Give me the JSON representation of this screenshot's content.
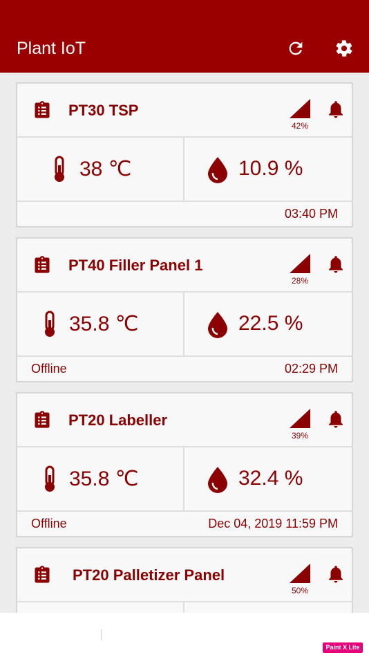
{
  "appbar": {
    "title": "Plant IoT",
    "refresh_icon": "refresh-icon",
    "settings_icon": "gear-icon"
  },
  "colors": {
    "primary": "#9b0000",
    "accent": "#8b0000",
    "background": "#ececec"
  },
  "devices": [
    {
      "name": "PT30 TSP",
      "signal": "42%",
      "temperature": "38 ℃",
      "humidity": "10.9 %",
      "status": "",
      "time": "03:40 PM"
    },
    {
      "name": "PT40 Filler Panel 1",
      "signal": "28%",
      "temperature": "35.8 ℃",
      "humidity": "22.5 %",
      "status": "Offline",
      "time": "02:29 PM"
    },
    {
      "name": "PT20 Labeller",
      "signal": "39%",
      "temperature": "35.8 ℃",
      "humidity": "32.4 %",
      "status": "Offline",
      "time": "Dec 04, 2019 11:59 PM"
    },
    {
      "name": "PT20 Palletizer Panel",
      "signal": "50%",
      "temperature": "",
      "humidity": "",
      "status": "",
      "time": ""
    }
  ],
  "watermark": "Paint X Lite"
}
